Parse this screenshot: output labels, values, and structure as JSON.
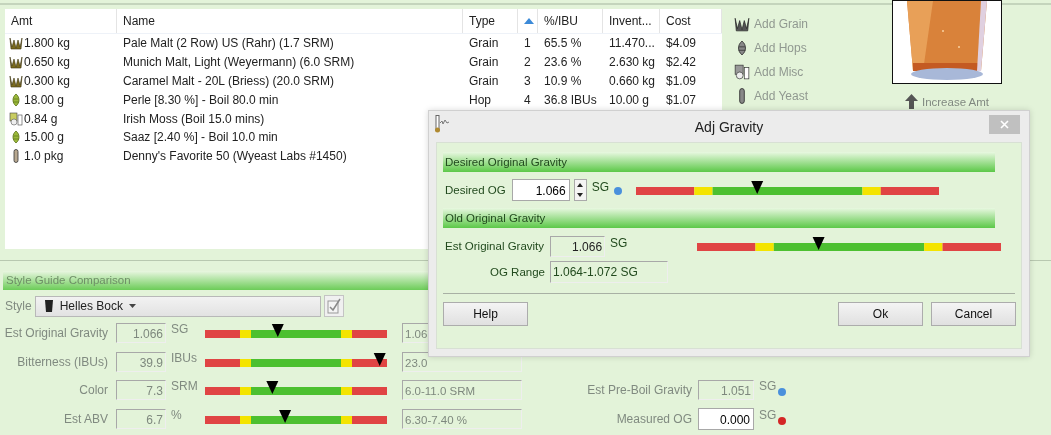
{
  "ingredients": {
    "columns": [
      {
        "label": "Amt",
        "sorted": false
      },
      {
        "label": "Name",
        "sorted": false
      },
      {
        "label": "Type",
        "sorted": false
      },
      {
        "sorted": true
      },
      {
        "label": "%/IBU",
        "sorted": false
      },
      {
        "label": "Invent...",
        "sorted": false
      },
      {
        "label": "Cost",
        "sorted": false
      }
    ],
    "rows": [
      {
        "kind": "grain",
        "amount": "1.800 kg",
        "name": "Pale Malt (2 Row) US (Rahr) (1.7 SRM)",
        "type": "Grain",
        "order": "1",
        "percent_ibu": "65.5 %",
        "inventory": "11.470...",
        "cost": "$4.09"
      },
      {
        "kind": "grain",
        "amount": "0.650 kg",
        "name": "Munich Malt, Light (Weyermann) (6.0 SRM)",
        "type": "Grain",
        "order": "2",
        "percent_ibu": "23.6 %",
        "inventory": "2.630 kg",
        "cost": "$2.42"
      },
      {
        "kind": "grain",
        "amount": "0.300 kg",
        "name": "Caramel Malt - 20L (Briess) (20.0 SRM)",
        "type": "Grain",
        "order": "3",
        "percent_ibu": "10.9 %",
        "inventory": "0.660 kg",
        "cost": "$1.09"
      },
      {
        "kind": "hop",
        "amount": "18.00 g",
        "name": "Perle [8.30 %] - Boil 80.0 min",
        "type": "Hop",
        "order": "4",
        "percent_ibu": "36.8 IBUs",
        "inventory": "10.00 g",
        "cost": "$1.07"
      },
      {
        "kind": "misc",
        "amount": "0.84 g",
        "name": "Irish Moss (Boil 15.0 mins)"
      },
      {
        "kind": "hop",
        "amount": "15.00 g",
        "name": "Saaz [2.40 %] - Boil 10.0 min"
      },
      {
        "kind": "yeast",
        "amount": "1.0 pkg",
        "name": "Denny's Favorite 50 (Wyeast Labs #1450)"
      }
    ]
  },
  "actions": [
    {
      "kind": "grain",
      "label": "Add Grain"
    },
    {
      "kind": "hop",
      "label": "Add Hops"
    },
    {
      "kind": "misc",
      "label": "Add Misc"
    },
    {
      "kind": "yeast",
      "label": "Add Yeast"
    }
  ],
  "increase_button": "Increase Amt",
  "style_guide": {
    "title": "Style Guide Comparison",
    "style_label": "Style",
    "style": "Helles Bock",
    "rows": [
      {
        "label": "Est Original Gravity",
        "value": "1.066",
        "unit": "SG",
        "level": 0.4,
        "range": "1.06"
      },
      {
        "label": "Bitterness (IBUs)",
        "value": "39.9",
        "unit": "IBUs",
        "level": 0.96,
        "range": "23.0"
      },
      {
        "label": "Color",
        "value": "7.3",
        "unit": "SRM",
        "level": 0.37,
        "range": "6.0-11.0 SRM"
      },
      {
        "label": "Est ABV",
        "value": "6.7",
        "unit": "%",
        "level": 0.44,
        "range": "6.30-7.40 %"
      }
    ]
  },
  "gravity": [
    {
      "label": "Est Pre-Boil Gravity",
      "value": "1.051",
      "unit": "SG",
      "editable": false,
      "color": "#4a90dc"
    },
    {
      "label": "Measured OG",
      "value": "0.000",
      "unit": "SG",
      "editable": true,
      "color": "#d42626"
    }
  ],
  "dialog": {
    "title": "Adj Gravity",
    "desired": {
      "heading": "Desired Original Gravity",
      "label": "Desired OG",
      "value": "1.066",
      "unit": "SG",
      "color": "#4a90dc",
      "level": 0.4
    },
    "old": {
      "heading": "Old Original Gravity",
      "label": "Est Original Gravity",
      "value": "1.066",
      "unit": "SG",
      "level": 0.4,
      "range_label": "OG Range",
      "range": "1.064-1.072 SG"
    },
    "buttons": [
      "Help",
      "Ok",
      "Cancel"
    ]
  }
}
